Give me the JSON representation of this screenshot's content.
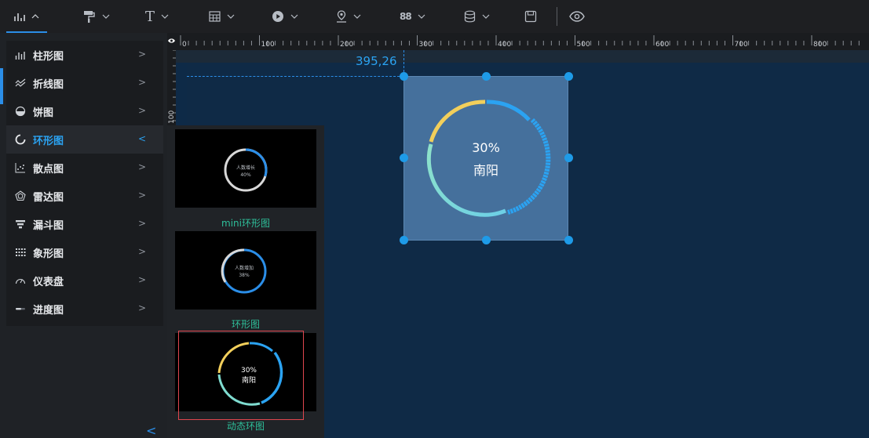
{
  "toolbar": {
    "items": [
      {
        "icon": "bar-chart-icon",
        "chevron": "up"
      },
      {
        "icon": "paint-roller-icon",
        "chevron": "down"
      },
      {
        "icon": "text-icon",
        "label": "T",
        "chevron": "down"
      },
      {
        "icon": "table-icon",
        "chevron": "down"
      },
      {
        "icon": "play-icon",
        "chevron": "down"
      },
      {
        "icon": "map-pin-icon",
        "chevron": "down"
      },
      {
        "icon": "grid-88-icon",
        "label": "88",
        "chevron": "down"
      },
      {
        "icon": "database-icon",
        "chevron": "down"
      },
      {
        "icon": "save-icon"
      },
      {
        "icon": "eye-icon"
      }
    ]
  },
  "menu": {
    "items": [
      {
        "label": "柱形图",
        "icon": "bar-chart-icon"
      },
      {
        "label": "折线图",
        "icon": "line-chart-icon"
      },
      {
        "label": "饼图",
        "icon": "pie-chart-icon"
      },
      {
        "label": "环形图",
        "icon": "ring-chart-icon",
        "active": true
      },
      {
        "label": "散点图",
        "icon": "scatter-chart-icon"
      },
      {
        "label": "雷达图",
        "icon": "radar-chart-icon"
      },
      {
        "label": "漏斗图",
        "icon": "funnel-chart-icon"
      },
      {
        "label": "象形图",
        "icon": "pictorial-chart-icon"
      },
      {
        "label": "仪表盘",
        "icon": "gauge-icon"
      },
      {
        "label": "进度图",
        "icon": "progress-chart-icon"
      }
    ]
  },
  "subpanel": {
    "thumbs": [
      {
        "label": "mini环形图",
        "center_text": "人数增长",
        "center_value": "40%",
        "progress": 0.4
      },
      {
        "label": "环形图",
        "center_text": "人数增加",
        "center_value": "38%",
        "progress": 0.38
      },
      {
        "label": "动态环图",
        "center_value": "30%",
        "center_text": "南阳",
        "selected": true
      }
    ]
  },
  "ruler": {
    "labels": [
      "0",
      "100",
      "200",
      "300",
      "400",
      "500",
      "600",
      "700",
      "800"
    ],
    "left_label": "100"
  },
  "canvas": {
    "coord": "395,26",
    "widget": {
      "value": "30%",
      "city": "南阳"
    }
  },
  "colors": {
    "accent": "#2b8ee8",
    "ring_yellow": "#f2cf5b",
    "ring_teal": "#7fdcd0",
    "ring_blue": "#2ba3f2",
    "thumb_label": "#2ebf9a"
  }
}
